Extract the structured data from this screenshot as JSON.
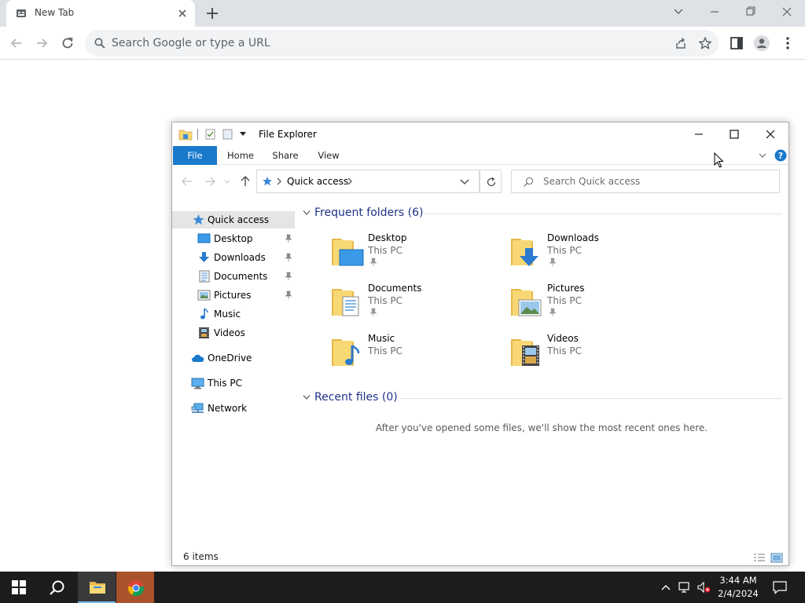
{
  "browser": {
    "tab_title": "New Tab",
    "omnibox_placeholder": "Search Google or type a URL"
  },
  "explorer": {
    "window_title": "File Explorer",
    "ribbon_tabs": [
      "File",
      "Home",
      "Share",
      "View"
    ],
    "breadcrumb": "Quick access",
    "search_placeholder": "Search Quick access",
    "nav_items": [
      {
        "label": "Quick access",
        "icon": "star-icon",
        "pinned": false
      },
      {
        "label": "Desktop",
        "icon": "desktop-icon",
        "pinned": true
      },
      {
        "label": "Downloads",
        "icon": "download-arrow-icon",
        "pinned": true
      },
      {
        "label": "Documents",
        "icon": "document-icon",
        "pinned": true
      },
      {
        "label": "Pictures",
        "icon": "picture-icon",
        "pinned": true
      },
      {
        "label": "Music",
        "icon": "music-note-icon",
        "pinned": false
      },
      {
        "label": "Videos",
        "icon": "film-icon",
        "pinned": false
      },
      {
        "label": "OneDrive",
        "icon": "cloud-icon",
        "pinned": false
      },
      {
        "label": "This PC",
        "icon": "computer-icon",
        "pinned": false
      },
      {
        "label": "Network",
        "icon": "network-icon",
        "pinned": false
      }
    ],
    "frequent_header": "Frequent folders (6)",
    "frequent_folders": [
      {
        "name": "Desktop",
        "location": "This PC",
        "pinned": true
      },
      {
        "name": "Downloads",
        "location": "This PC",
        "pinned": true
      },
      {
        "name": "Documents",
        "location": "This PC",
        "pinned": true
      },
      {
        "name": "Pictures",
        "location": "This PC",
        "pinned": true
      },
      {
        "name": "Music",
        "location": "This PC",
        "pinned": false
      },
      {
        "name": "Videos",
        "location": "This PC",
        "pinned": false
      }
    ],
    "recent_header": "Recent files (0)",
    "recent_empty": "After you've opened some files, we'll show the most recent ones here.",
    "status_text": "6 items"
  },
  "taskbar": {
    "time": "3:44 AM",
    "date": "2/4/2024"
  },
  "colors": {
    "ribbon_file_tab": "#1979ca",
    "group_header": "#1e3287",
    "folder_yellow": "#f8d775",
    "taskbar_bg": "#1c1c1c"
  }
}
